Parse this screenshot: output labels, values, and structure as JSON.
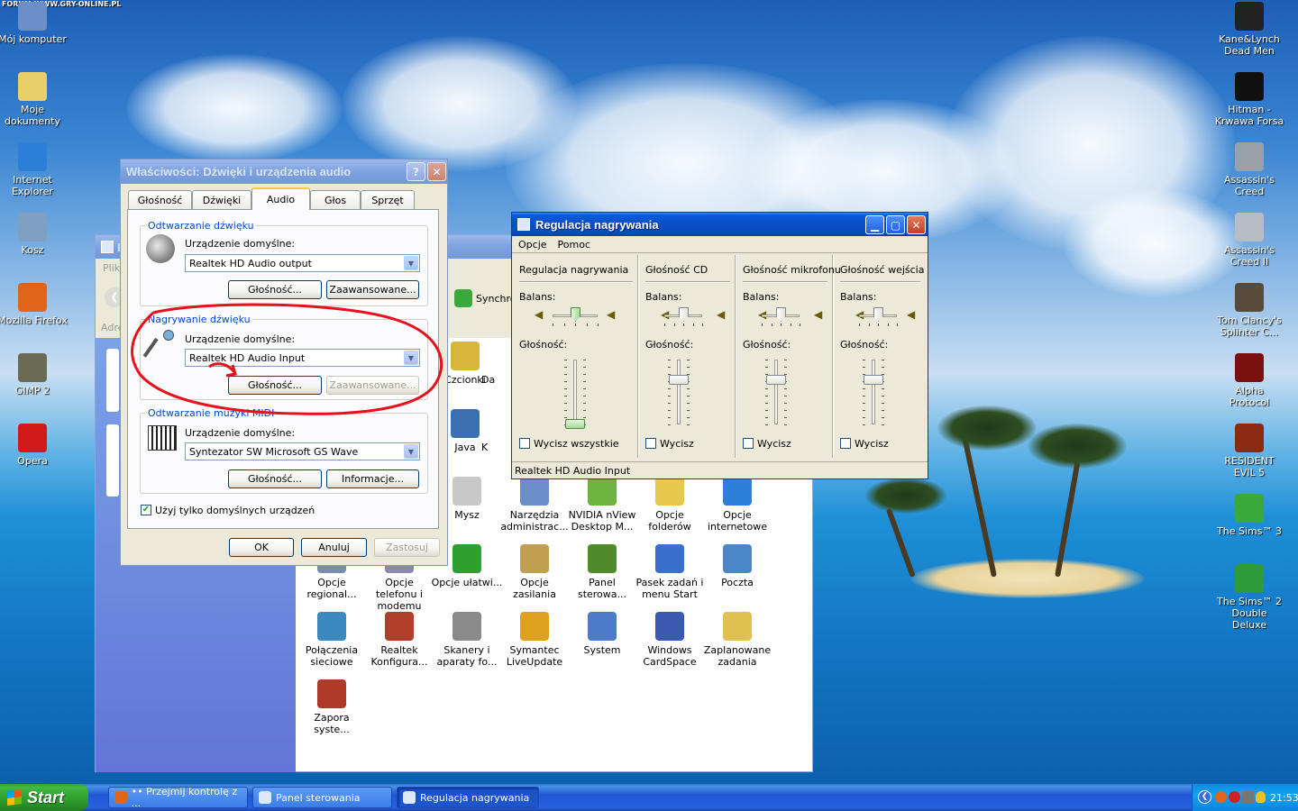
{
  "watermark": "FORUM WWW.GRY-ONLINE.PL",
  "desktop_left": [
    {
      "label": "Mój komputer",
      "icon": "computer-icon",
      "color": "#6c8fc9"
    },
    {
      "label": "Moje dokumenty",
      "icon": "folder-icon",
      "color": "#e9cf6a"
    },
    {
      "label": "Internet Explorer",
      "icon": "ie-icon",
      "color": "#2e7fd8"
    },
    {
      "label": "Kosz",
      "icon": "recycle-bin-icon",
      "color": "#7fa0c0"
    },
    {
      "label": "Mozilla Firefox",
      "icon": "firefox-icon",
      "color": "#e0641a"
    },
    {
      "label": "GIMP 2",
      "icon": "gimp-icon",
      "color": "#6b6b55"
    },
    {
      "label": "Opera",
      "icon": "opera-icon",
      "color": "#d01a1a"
    }
  ],
  "desktop_right": [
    {
      "label": "Kane&Lynch Dead Men",
      "icon": "kane-lynch-icon",
      "color": "#222222"
    },
    {
      "label": "Hitman - Krwawa Forsa",
      "icon": "hitman-icon",
      "color": "#111111"
    },
    {
      "label": "Assassin's Creed",
      "icon": "assassins-creed-icon",
      "color": "#9aa0a8"
    },
    {
      "label": "Assassin's Creed II",
      "icon": "assassins-creed-2-icon",
      "color": "#b8bcc4"
    },
    {
      "label": "Tom Clancy's Splinter C...",
      "icon": "splinter-cell-icon",
      "color": "#5a4a3a"
    },
    {
      "label": "Alpha Protocol",
      "icon": "alpha-protocol-icon",
      "color": "#7a1010"
    },
    {
      "label": "RESIDENT EVIL 5",
      "icon": "resident-evil-icon",
      "color": "#8a2a10"
    },
    {
      "label": "The Sims™ 3",
      "icon": "sims3-icon",
      "color": "#3aa83a"
    },
    {
      "label": "The Sims™ 2 Double Deluxe",
      "icon": "sims2-icon",
      "color": "#2e9a3a"
    }
  ],
  "control_panel": {
    "title_short": "P",
    "menu_short": "Plik",
    "address_short": "Adres",
    "sync_label": "Synchro",
    "icons": [
      {
        "label": "Czcionki",
        "icon": "fonts-icon",
        "color": "#d9b53a"
      },
      {
        "label": "Da",
        "icon": "partial-icon",
        "color": "#ffffff"
      },
      {
        "label": "Java",
        "icon": "java-icon",
        "color": "#3a6fb0"
      },
      {
        "label": "K",
        "icon": "partial-icon",
        "color": "#ffffff"
      },
      {
        "label": "Mysz",
        "icon": "mouse-icon",
        "color": "#c8c8c8"
      },
      {
        "label": "Narzędzia administrac...",
        "icon": "admin-tools-icon",
        "color": "#6a8ec8"
      },
      {
        "label": "NVIDIA nView Desktop M...",
        "icon": "nvidia-icon",
        "color": "#6db33f"
      },
      {
        "label": "Opcje folderów",
        "icon": "folder-options-icon",
        "color": "#e8c84a"
      },
      {
        "label": "Opcje internetowe",
        "icon": "internet-options-icon",
        "color": "#2e7fd8"
      },
      {
        "label": "Opcje regional...",
        "icon": "regional-icon",
        "color": "#7a8ab0"
      },
      {
        "label": "Opcje telefonu i modemu",
        "icon": "phone-icon",
        "color": "#8a8ab0"
      },
      {
        "label": "Opcje ułatwi...",
        "icon": "accessibility-icon",
        "color": "#2f9f2f"
      },
      {
        "label": "Opcje zasilania",
        "icon": "power-icon",
        "color": "#c0a050"
      },
      {
        "label": "Panel sterowa...",
        "icon": "nvidia-panel-icon",
        "color": "#4d8a2a"
      },
      {
        "label": "Pasek zadań i menu Start",
        "icon": "taskbar-icon",
        "color": "#3a6fd0"
      },
      {
        "label": "Poczta",
        "icon": "mail-icon",
        "color": "#4a86c8"
      },
      {
        "label": "Połączenia sieciowe",
        "icon": "network-icon",
        "color": "#3a8ac0"
      },
      {
        "label": "Realtek Konfigura...",
        "icon": "realtek-icon",
        "color": "#b0402a"
      },
      {
        "label": "Skanery i aparaty fo...",
        "icon": "scanner-icon",
        "color": "#8a8a8a"
      },
      {
        "label": "Symantec LiveUpdate",
        "icon": "symantec-icon",
        "color": "#e0a020"
      },
      {
        "label": "System",
        "icon": "system-icon",
        "color": "#4a7ac8"
      },
      {
        "label": "Windows CardSpace",
        "icon": "cardspace-icon",
        "color": "#3a5ab0"
      },
      {
        "label": "Zaplanowane zadania",
        "icon": "scheduled-tasks-icon",
        "color": "#e0c050"
      },
      {
        "label": "Zapora syste...",
        "icon": "firewall-icon",
        "color": "#b03a2a"
      }
    ]
  },
  "audio_dialog": {
    "title": "Właściwości: Dźwięki i urządzenia audio",
    "help_glyph": "?",
    "close_glyph": "✕",
    "tabs": [
      "Głośność",
      "Dźwięki",
      "Audio",
      "Głos",
      "Sprzęt"
    ],
    "active_tab": "Audio",
    "playback": {
      "legend": "Odtwarzanie dźwięku",
      "device_label": "Urządzenie domyślne:",
      "device_value": "Realtek HD Audio output",
      "btn_volume": "Głośność...",
      "btn_advanced": "Zaawansowane..."
    },
    "recording": {
      "legend": "Nagrywanie dźwięku",
      "device_label": "Urządzenie domyślne:",
      "device_value": "Realtek HD Audio Input",
      "btn_volume": "Głośność...",
      "btn_advanced": "Zaawansowane..."
    },
    "midi": {
      "legend": "Odtwarzanie muzyki MIDI",
      "device_label": "Urządzenie domyślne:",
      "device_value": "Syntezator SW Microsoft GS Wave",
      "btn_volume": "Głośność...",
      "btn_info": "Informacje..."
    },
    "only_default_label": "Użyj tylko domyślnych urządzeń",
    "only_default_checked": true,
    "ok": "OK",
    "cancel": "Anuluj",
    "apply": "Zastosuj",
    "annotation_color": "#e8101a"
  },
  "mixer": {
    "title": "Regulacja nagrywania",
    "menu": [
      "Opcje",
      "Pomoc"
    ],
    "balance_label": "Balans:",
    "volume_label": "Głośność:",
    "columns": [
      {
        "name": "Regulacja nagrywania",
        "mute_label": "Wycisz wszystkie",
        "muted": false,
        "volume": 0.0,
        "balance": 0.5,
        "selected": true
      },
      {
        "name": "Głośność CD",
        "mute_label": "Wycisz",
        "muted": false,
        "volume": 0.75,
        "balance": 0.5,
        "selected": false
      },
      {
        "name": "Głośność mikrofonu",
        "mute_label": "Wycisz",
        "muted": false,
        "volume": 0.75,
        "balance": 0.5,
        "selected": false
      },
      {
        "name": "Głośność wejścia",
        "mute_label": "Wycisz",
        "muted": false,
        "volume": 0.75,
        "balance": 0.5,
        "selected": false
      }
    ],
    "status": "Realtek HD Audio Input"
  },
  "taskbar": {
    "start": "Start",
    "tasks": [
      {
        "label": "•• Przejmij kontrolę z ...",
        "icon": "firefox-icon",
        "active": false
      },
      {
        "label": "Panel sterowania",
        "icon": "control-panel-icon",
        "active": false
      },
      {
        "label": "Regulacja nagrywania",
        "icon": "mixer-icon",
        "active": true
      }
    ],
    "clock": "21:53"
  }
}
